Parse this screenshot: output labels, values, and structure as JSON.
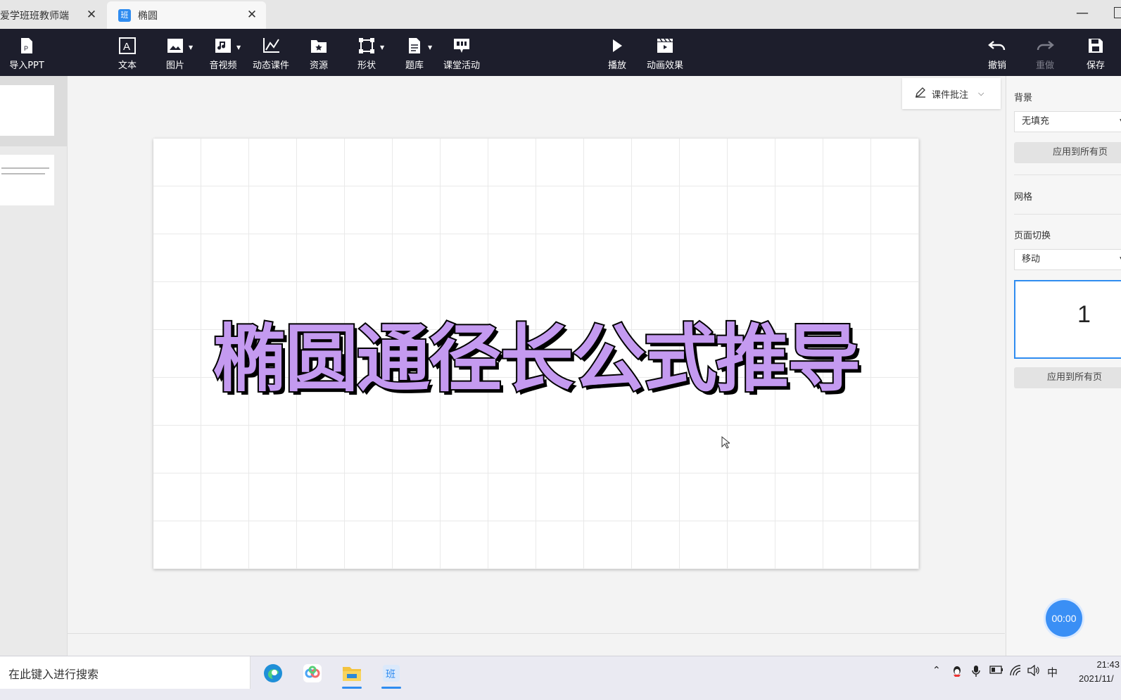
{
  "tabs": [
    {
      "label": "爱学班班教师端",
      "active": false
    },
    {
      "label": "椭圆",
      "active": true,
      "icon_text": "班"
    }
  ],
  "toolbar": {
    "items": [
      {
        "key": "import",
        "label": "导入PPT",
        "icon": "ppt-file-icon"
      },
      {
        "key": "text",
        "label": "文本",
        "icon": "text-icon"
      },
      {
        "key": "image",
        "label": "图片",
        "icon": "image-icon"
      },
      {
        "key": "media",
        "label": "音视频",
        "icon": "music-video-icon"
      },
      {
        "key": "dynamic",
        "label": "动态课件",
        "icon": "graph-icon"
      },
      {
        "key": "resource",
        "label": "资源",
        "icon": "folder-star-icon"
      },
      {
        "key": "shape",
        "label": "形状",
        "icon": "shape-icon"
      },
      {
        "key": "quiz",
        "label": "题库",
        "icon": "document-icon"
      },
      {
        "key": "activity",
        "label": "课堂活动",
        "icon": "chat-board-icon"
      },
      {
        "key": "play",
        "label": "播放",
        "icon": "play-icon"
      },
      {
        "key": "animation",
        "label": "动画效果",
        "icon": "clapper-icon"
      },
      {
        "key": "undo",
        "label": "撤销",
        "icon": "undo-icon"
      },
      {
        "key": "redo",
        "label": "重做",
        "icon": "redo-icon",
        "disabled": true
      },
      {
        "key": "save",
        "label": "保存",
        "icon": "save-icon"
      }
    ]
  },
  "slide": {
    "title": "椭圆通径长公式推导",
    "title_color": "#c49af0"
  },
  "annotation": {
    "label": "课件批注"
  },
  "right_panel": {
    "background_label": "背景",
    "background_value": "无填充",
    "apply_all_1": "应用到所有页",
    "grid_label": "网格",
    "transition_label": "页面切换",
    "transition_value": "移动",
    "preview_number": "1",
    "apply_all_2": "应用到所有页"
  },
  "timer": "00:00",
  "taskbar": {
    "search_placeholder": "在此键入进行搜索",
    "ime": "中",
    "time": "21:43",
    "date": "2021/11/"
  },
  "colors": {
    "accent": "#2f8cf0",
    "toolbar_bg": "#1d1e2c"
  }
}
